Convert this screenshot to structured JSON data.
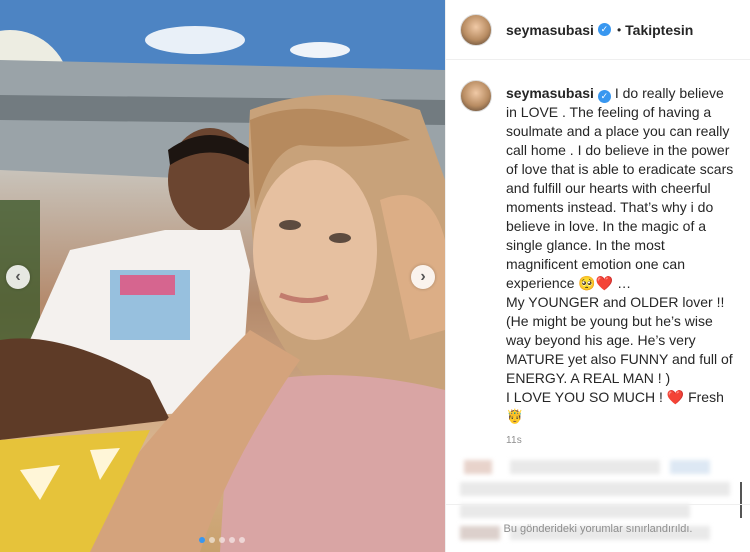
{
  "post": {
    "username": "seymasubasi",
    "follow_label": "Takiptesin",
    "caption": [
      {
        "text": "I do really believe in LOVE . The feeling of having a soulmate and a place you can really call home . I do believe in the power of love that is able to eradicate scars and fulfill our hearts with cheerful moments instead. That’s why i do believe in love. In the magic of a single glance. In the most magnificent emotion one can experience 🥺❤️ …"
      },
      {
        "text": "My YOUNGER and OLDER lover !! (He might be young but he’s wise way beyond his age. He’s very MATURE yet also FUNNY and full of ENERGY. A REAL MAN ! )"
      },
      {
        "text": "I LOVE YOU SO MUCH ! ❤️ Fresh 🤴"
      }
    ],
    "time": "11s",
    "comments_restricted": "Bu gönderideki yorumlar sınırlandırıldı."
  },
  "carousel": {
    "prev_icon": "‹",
    "next_icon": "›",
    "slide_count": 5,
    "active_slide": 0
  },
  "colors": {
    "accent": "#3897f0",
    "text": "#262626",
    "muted": "#8e8e8e",
    "border": "#efefef"
  }
}
